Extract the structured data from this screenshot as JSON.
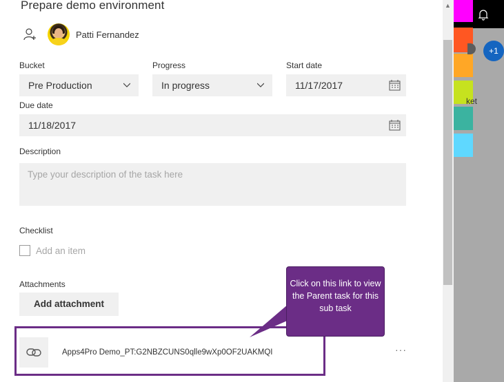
{
  "task": {
    "title": "Prepare demo environment",
    "assignee": "Patti Fernandez"
  },
  "fields": {
    "bucket_label": "Bucket",
    "bucket_value": "Pre Production",
    "progress_label": "Progress",
    "progress_value": "In progress",
    "start_label": "Start date",
    "start_value": "11/17/2017",
    "due_label": "Due date",
    "due_value": "11/18/2017",
    "description_label": "Description",
    "description_placeholder": "Type your description of the task here"
  },
  "checklist": {
    "label": "Checklist",
    "placeholder": "Add an item"
  },
  "attachments": {
    "label": "Attachments",
    "button": "Add attachment",
    "link_text": "Apps4Pro Demo_PT:G2NBZCUNS0qlle9wXp0OF2UAKMQI",
    "more": "···"
  },
  "callout": {
    "text": "Click on this link to view the Parent task for this sub task"
  },
  "sidebar": {
    "badge": "+1",
    "partial_text": "ket"
  },
  "colors": {
    "accent_purple": "#6b2d86",
    "field_bg": "#f0f0f0",
    "swatches": [
      "#ff00ff",
      "#ff5722",
      "#ffa726",
      "#c6e21f",
      "#3bb3a0",
      "#5fd8ff"
    ]
  }
}
